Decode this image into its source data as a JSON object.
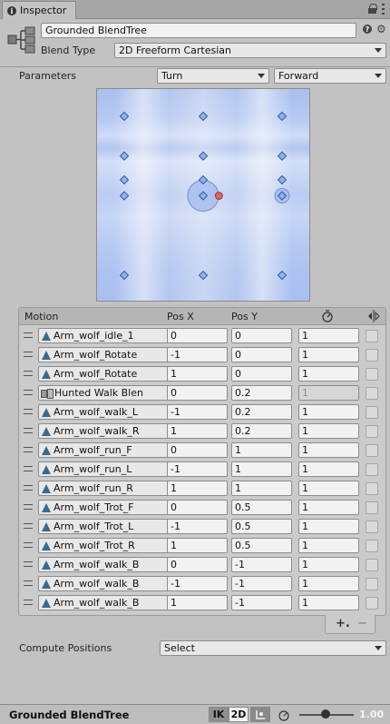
{
  "window": {
    "tab_label": "Inspector"
  },
  "header": {
    "name": "Grounded BlendTree",
    "blend_type_label": "Blend Type",
    "blend_type_value": "2D Freeform Cartesian"
  },
  "parameters": {
    "label": "Parameters",
    "x_param": "Turn",
    "y_param": "Forward"
  },
  "graph": {
    "current_position": {
      "x": 0.2,
      "y": 0
    },
    "points": [
      {
        "x": -1,
        "y": 1
      },
      {
        "x": 0,
        "y": 1
      },
      {
        "x": 1,
        "y": 1
      },
      {
        "x": -1,
        "y": 0.5
      },
      {
        "x": 0,
        "y": 0.5
      },
      {
        "x": 1,
        "y": 0.5
      },
      {
        "x": -1,
        "y": 0.2
      },
      {
        "x": 0,
        "y": 0.2
      },
      {
        "x": 1,
        "y": 0.2
      },
      {
        "x": -1,
        "y": 0
      },
      {
        "x": 0,
        "y": 0
      },
      {
        "x": 1,
        "y": 0
      },
      {
        "x": -1,
        "y": -1
      },
      {
        "x": 0,
        "y": -1
      },
      {
        "x": 1,
        "y": -1
      }
    ],
    "colors": {
      "background": "#bccdf0",
      "point": "#8fb2ee",
      "point_stroke": "#2b5db2",
      "current": "#e0605a"
    }
  },
  "motion_list": {
    "columns": {
      "motion": "Motion",
      "pos_x": "Pos X",
      "pos_y": "Pos Y"
    },
    "rows": [
      {
        "motion": "Arm_wolf_idle_1",
        "type": "clip",
        "pos_x": "0",
        "pos_y": "0",
        "speed": "1",
        "speed_disabled": false
      },
      {
        "motion": "Arm_wolf_Rotate",
        "type": "clip",
        "pos_x": "-1",
        "pos_y": "0",
        "speed": "1",
        "speed_disabled": false
      },
      {
        "motion": "Arm_wolf_Rotate",
        "type": "clip",
        "pos_x": "1",
        "pos_y": "0",
        "speed": "1",
        "speed_disabled": false
      },
      {
        "motion": "Hunted Walk Blen",
        "type": "tree",
        "pos_x": "0",
        "pos_y": "0.2",
        "speed": "1",
        "speed_disabled": true
      },
      {
        "motion": "Arm_wolf_walk_L",
        "type": "clip",
        "pos_x": "-1",
        "pos_y": "0.2",
        "speed": "1",
        "speed_disabled": false
      },
      {
        "motion": "Arm_wolf_walk_R",
        "type": "clip",
        "pos_x": "1",
        "pos_y": "0.2",
        "speed": "1",
        "speed_disabled": false
      },
      {
        "motion": "Arm_wolf_run_F",
        "type": "clip",
        "pos_x": "0",
        "pos_y": "1",
        "speed": "1",
        "speed_disabled": false
      },
      {
        "motion": "Arm_wolf_run_L",
        "type": "clip",
        "pos_x": "-1",
        "pos_y": "1",
        "speed": "1",
        "speed_disabled": false
      },
      {
        "motion": "Arm_wolf_run_R",
        "type": "clip",
        "pos_x": "1",
        "pos_y": "1",
        "speed": "1",
        "speed_disabled": false
      },
      {
        "motion": "Arm_wolf_Trot_F",
        "type": "clip",
        "pos_x": "0",
        "pos_y": "0.5",
        "speed": "1",
        "speed_disabled": false
      },
      {
        "motion": "Arm_wolf_Trot_L",
        "type": "clip",
        "pos_x": "-1",
        "pos_y": "0.5",
        "speed": "1",
        "speed_disabled": false
      },
      {
        "motion": "Arm_wolf_Trot_R",
        "type": "clip",
        "pos_x": "1",
        "pos_y": "0.5",
        "speed": "1",
        "speed_disabled": false
      },
      {
        "motion": "Arm_wolf_walk_B",
        "type": "clip",
        "pos_x": "0",
        "pos_y": "-1",
        "speed": "1",
        "speed_disabled": false
      },
      {
        "motion": "Arm_wolf_walk_B",
        "type": "clip",
        "pos_x": "-1",
        "pos_y": "-1",
        "speed": "1",
        "speed_disabled": false
      },
      {
        "motion": "Arm_wolf_walk_B",
        "type": "clip",
        "pos_x": "1",
        "pos_y": "-1",
        "speed": "1",
        "speed_disabled": false
      }
    ],
    "add_label": "+.",
    "remove_label": "−"
  },
  "compute": {
    "label": "Compute Positions",
    "value": "Select"
  },
  "status_bar": {
    "title": "Grounded BlendTree",
    "ik_label": "IK",
    "mode_2d_label": "2D",
    "playback_speed": "1.00"
  }
}
